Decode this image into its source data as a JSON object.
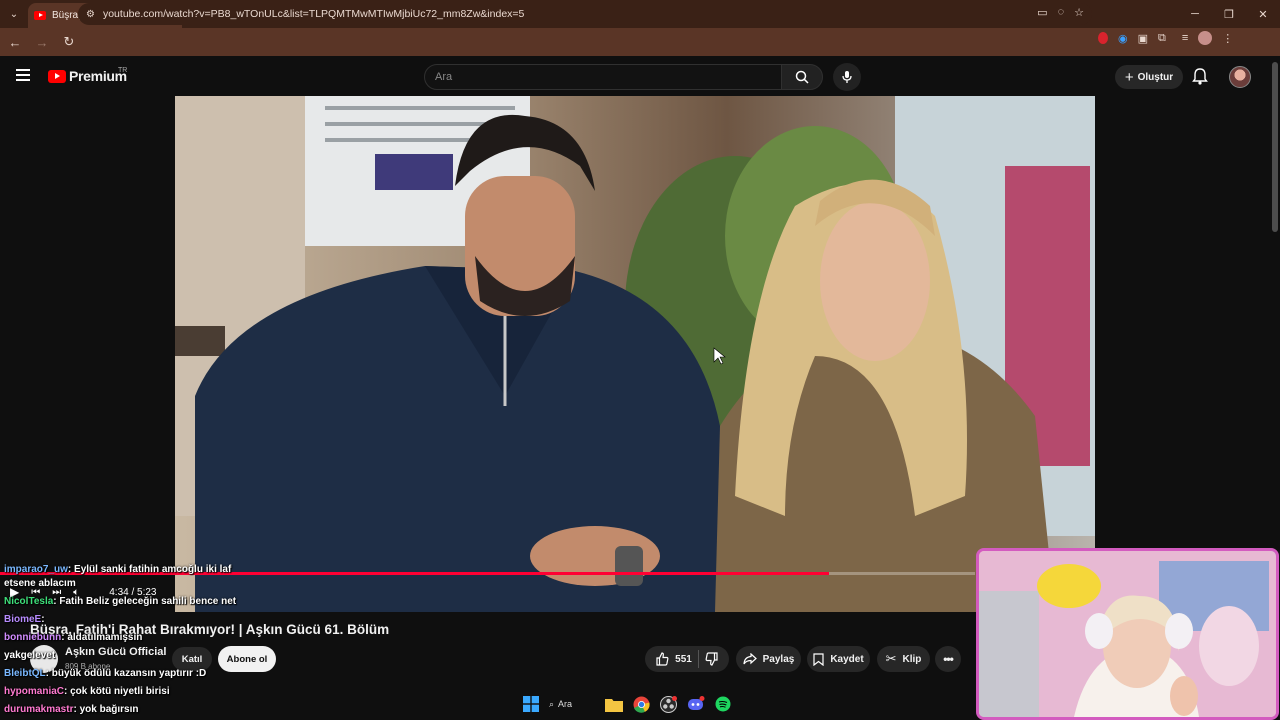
{
  "browser": {
    "tab_title": "Büşra, Fatih'i Rahat Bırakmıyor!",
    "url": "youtube.com/watch?v=PB8_wTOnULc&list=TLPQMTMwMTIwMjbiUc72_mm8Zw&index=5"
  },
  "header": {
    "logo_text": "Premium",
    "country": "TR",
    "search_placeholder": "Ara",
    "create_label": "Oluştur"
  },
  "player": {
    "time": "4:34 / 5:23",
    "progress": 0.85
  },
  "video": {
    "title": "Büşra, Fatih'i Rahat Bırakmıyor! | Aşkın Gücü 61. Bölüm",
    "channel": "Aşkın Gücü Official",
    "subscribers": "809 B abone",
    "join_label": "Katıl",
    "subscribe_label": "Abone ol",
    "likes": "551",
    "share_label": "Paylaş",
    "save_label": "Kaydet",
    "clip_label": "Klip"
  },
  "chat": [
    {
      "user": "imparao7_uw",
      "msg": ": Eylül sanki fatihin amcoğlu iki laf",
      "color": "#7ab8ff"
    },
    {
      "user": "",
      "msg": "etsene ablacım",
      "color": "#ffffff"
    },
    {
      "user": "NicolTesla",
      "msg": ": Fatih Beliz geleceğin sahili bence net",
      "color": "#3ee07a"
    },
    {
      "user": "BiomeE",
      "msg": ":",
      "color": "#b88cff"
    },
    {
      "user": "bonniebunn",
      "msg": ": aldatılmamışsın",
      "color": "#d28cff"
    },
    {
      "user": "yakgelevet",
      "msg": "",
      "color": "#ffffff"
    },
    {
      "user": "BleibtQL",
      "msg": ": büyük ödülü kazansın yaptırır :D",
      "color": "#7ab8ff"
    },
    {
      "user": "hypomaniaC",
      "msg": ": çok kötü niyetli birisi",
      "color": "#ff7ad0"
    },
    {
      "user": "durumakmastr",
      "msg": ": yok bağırsın",
      "color": "#ff7ad0"
    }
  ],
  "taskbar": {
    "search_label": "Ara"
  },
  "colors": {
    "accent_red": "#ff0033",
    "tab_bg": "#3a2116",
    "webcam_border": "#d35bbf"
  }
}
